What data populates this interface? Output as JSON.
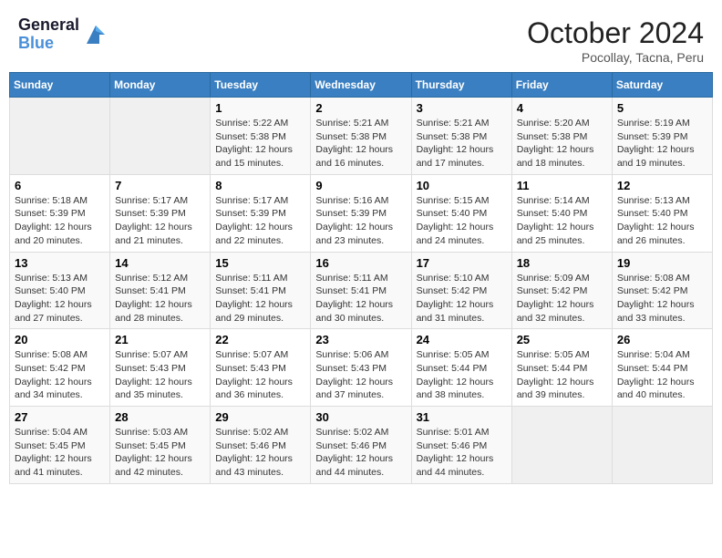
{
  "header": {
    "logo_line1": "General",
    "logo_line2": "Blue",
    "title": "October 2024",
    "subtitle": "Pocollay, Tacna, Peru"
  },
  "weekdays": [
    "Sunday",
    "Monday",
    "Tuesday",
    "Wednesday",
    "Thursday",
    "Friday",
    "Saturday"
  ],
  "weeks": [
    [
      {
        "day": "",
        "sunrise": "",
        "sunset": "",
        "daylight": ""
      },
      {
        "day": "",
        "sunrise": "",
        "sunset": "",
        "daylight": ""
      },
      {
        "day": "1",
        "sunrise": "Sunrise: 5:22 AM",
        "sunset": "Sunset: 5:38 PM",
        "daylight": "Daylight: 12 hours and 15 minutes."
      },
      {
        "day": "2",
        "sunrise": "Sunrise: 5:21 AM",
        "sunset": "Sunset: 5:38 PM",
        "daylight": "Daylight: 12 hours and 16 minutes."
      },
      {
        "day": "3",
        "sunrise": "Sunrise: 5:21 AM",
        "sunset": "Sunset: 5:38 PM",
        "daylight": "Daylight: 12 hours and 17 minutes."
      },
      {
        "day": "4",
        "sunrise": "Sunrise: 5:20 AM",
        "sunset": "Sunset: 5:38 PM",
        "daylight": "Daylight: 12 hours and 18 minutes."
      },
      {
        "day": "5",
        "sunrise": "Sunrise: 5:19 AM",
        "sunset": "Sunset: 5:39 PM",
        "daylight": "Daylight: 12 hours and 19 minutes."
      }
    ],
    [
      {
        "day": "6",
        "sunrise": "Sunrise: 5:18 AM",
        "sunset": "Sunset: 5:39 PM",
        "daylight": "Daylight: 12 hours and 20 minutes."
      },
      {
        "day": "7",
        "sunrise": "Sunrise: 5:17 AM",
        "sunset": "Sunset: 5:39 PM",
        "daylight": "Daylight: 12 hours and 21 minutes."
      },
      {
        "day": "8",
        "sunrise": "Sunrise: 5:17 AM",
        "sunset": "Sunset: 5:39 PM",
        "daylight": "Daylight: 12 hours and 22 minutes."
      },
      {
        "day": "9",
        "sunrise": "Sunrise: 5:16 AM",
        "sunset": "Sunset: 5:39 PM",
        "daylight": "Daylight: 12 hours and 23 minutes."
      },
      {
        "day": "10",
        "sunrise": "Sunrise: 5:15 AM",
        "sunset": "Sunset: 5:40 PM",
        "daylight": "Daylight: 12 hours and 24 minutes."
      },
      {
        "day": "11",
        "sunrise": "Sunrise: 5:14 AM",
        "sunset": "Sunset: 5:40 PM",
        "daylight": "Daylight: 12 hours and 25 minutes."
      },
      {
        "day": "12",
        "sunrise": "Sunrise: 5:13 AM",
        "sunset": "Sunset: 5:40 PM",
        "daylight": "Daylight: 12 hours and 26 minutes."
      }
    ],
    [
      {
        "day": "13",
        "sunrise": "Sunrise: 5:13 AM",
        "sunset": "Sunset: 5:40 PM",
        "daylight": "Daylight: 12 hours and 27 minutes."
      },
      {
        "day": "14",
        "sunrise": "Sunrise: 5:12 AM",
        "sunset": "Sunset: 5:41 PM",
        "daylight": "Daylight: 12 hours and 28 minutes."
      },
      {
        "day": "15",
        "sunrise": "Sunrise: 5:11 AM",
        "sunset": "Sunset: 5:41 PM",
        "daylight": "Daylight: 12 hours and 29 minutes."
      },
      {
        "day": "16",
        "sunrise": "Sunrise: 5:11 AM",
        "sunset": "Sunset: 5:41 PM",
        "daylight": "Daylight: 12 hours and 30 minutes."
      },
      {
        "day": "17",
        "sunrise": "Sunrise: 5:10 AM",
        "sunset": "Sunset: 5:42 PM",
        "daylight": "Daylight: 12 hours and 31 minutes."
      },
      {
        "day": "18",
        "sunrise": "Sunrise: 5:09 AM",
        "sunset": "Sunset: 5:42 PM",
        "daylight": "Daylight: 12 hours and 32 minutes."
      },
      {
        "day": "19",
        "sunrise": "Sunrise: 5:08 AM",
        "sunset": "Sunset: 5:42 PM",
        "daylight": "Daylight: 12 hours and 33 minutes."
      }
    ],
    [
      {
        "day": "20",
        "sunrise": "Sunrise: 5:08 AM",
        "sunset": "Sunset: 5:42 PM",
        "daylight": "Daylight: 12 hours and 34 minutes."
      },
      {
        "day": "21",
        "sunrise": "Sunrise: 5:07 AM",
        "sunset": "Sunset: 5:43 PM",
        "daylight": "Daylight: 12 hours and 35 minutes."
      },
      {
        "day": "22",
        "sunrise": "Sunrise: 5:07 AM",
        "sunset": "Sunset: 5:43 PM",
        "daylight": "Daylight: 12 hours and 36 minutes."
      },
      {
        "day": "23",
        "sunrise": "Sunrise: 5:06 AM",
        "sunset": "Sunset: 5:43 PM",
        "daylight": "Daylight: 12 hours and 37 minutes."
      },
      {
        "day": "24",
        "sunrise": "Sunrise: 5:05 AM",
        "sunset": "Sunset: 5:44 PM",
        "daylight": "Daylight: 12 hours and 38 minutes."
      },
      {
        "day": "25",
        "sunrise": "Sunrise: 5:05 AM",
        "sunset": "Sunset: 5:44 PM",
        "daylight": "Daylight: 12 hours and 39 minutes."
      },
      {
        "day": "26",
        "sunrise": "Sunrise: 5:04 AM",
        "sunset": "Sunset: 5:44 PM",
        "daylight": "Daylight: 12 hours and 40 minutes."
      }
    ],
    [
      {
        "day": "27",
        "sunrise": "Sunrise: 5:04 AM",
        "sunset": "Sunset: 5:45 PM",
        "daylight": "Daylight: 12 hours and 41 minutes."
      },
      {
        "day": "28",
        "sunrise": "Sunrise: 5:03 AM",
        "sunset": "Sunset: 5:45 PM",
        "daylight": "Daylight: 12 hours and 42 minutes."
      },
      {
        "day": "29",
        "sunrise": "Sunrise: 5:02 AM",
        "sunset": "Sunset: 5:46 PM",
        "daylight": "Daylight: 12 hours and 43 minutes."
      },
      {
        "day": "30",
        "sunrise": "Sunrise: 5:02 AM",
        "sunset": "Sunset: 5:46 PM",
        "daylight": "Daylight: 12 hours and 44 minutes."
      },
      {
        "day": "31",
        "sunrise": "Sunrise: 5:01 AM",
        "sunset": "Sunset: 5:46 PM",
        "daylight": "Daylight: 12 hours and 44 minutes."
      },
      {
        "day": "",
        "sunrise": "",
        "sunset": "",
        "daylight": ""
      },
      {
        "day": "",
        "sunrise": "",
        "sunset": "",
        "daylight": ""
      }
    ]
  ]
}
